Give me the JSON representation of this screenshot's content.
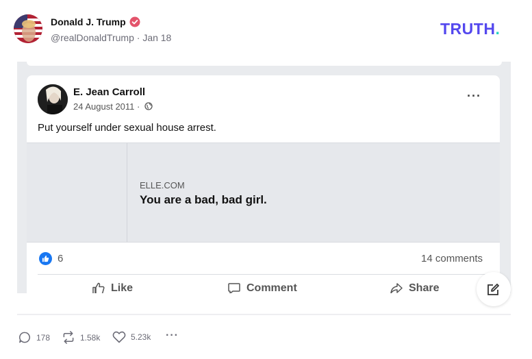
{
  "post": {
    "author_name": "Donald J. Trump",
    "handle": "@realDonaldTrump",
    "separator": " · ",
    "date": "Jan 18",
    "verified_color": "#e3536b",
    "avatar_icon": "flag-portrait-avatar"
  },
  "brand": {
    "logo_text": "TRUTH",
    "logo_dot": ".",
    "accent": "#5448ee",
    "dot_color": "#24d4c3"
  },
  "embedded_post": {
    "author_name": "E. Jean Carroll",
    "date": "24 August 2011",
    "date_separator": " · ",
    "privacy_icon": "globe-icon",
    "more_label": "···",
    "text": "Put yourself under sexual house arrest.",
    "link": {
      "domain": "ELLE.COM",
      "title": "You are a bad, bad girl."
    },
    "reaction_count": "6",
    "comments": "14 comments",
    "actions": {
      "like": "Like",
      "comment": "Comment",
      "share": "Share"
    },
    "accent": "#1877f2"
  },
  "actions_bar": {
    "replies": "178",
    "retruths": "1.58k",
    "likes": "5.23k",
    "more": "···"
  }
}
